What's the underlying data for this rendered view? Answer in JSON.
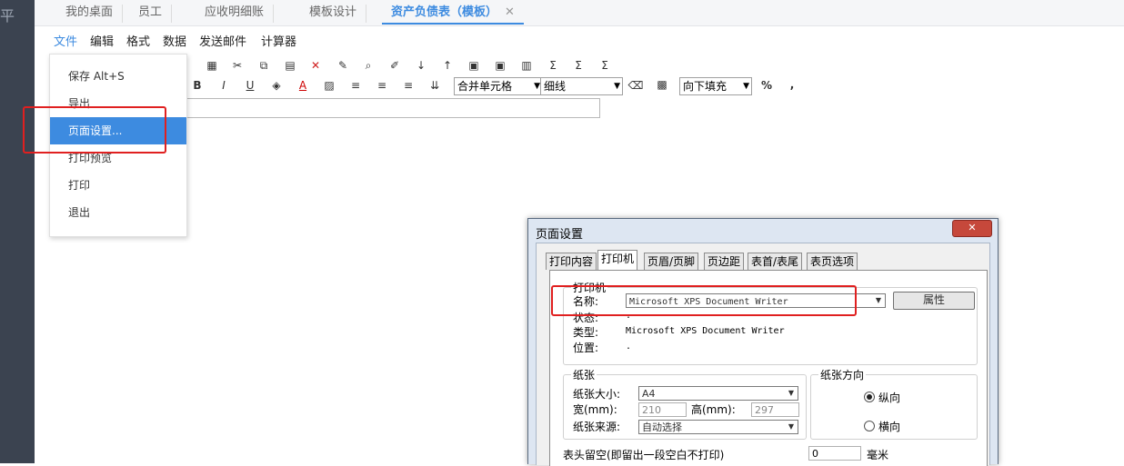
{
  "sidebar": {
    "glyph": "平"
  },
  "tabs": [
    {
      "label": "我的桌面"
    },
    {
      "label": "员工"
    },
    {
      "label": "应收明细账"
    },
    {
      "label": "模板设计"
    },
    {
      "label": "资产负债表（模板）",
      "close": "✕"
    }
  ],
  "menubar": {
    "items": [
      "文件",
      "编辑",
      "格式",
      "数据",
      "发送邮件",
      "计算器"
    ]
  },
  "toolbar": {
    "merge_select": "合并单元格",
    "line_select": "细线",
    "fill_select": "向下填充",
    "percent": "%",
    "comma": ","
  },
  "file_menu": {
    "items": [
      "保存 Alt+S",
      "导出",
      "页面设置...",
      "打印预览",
      "打印",
      "退出"
    ]
  },
  "dialog": {
    "title": "页面设置",
    "close": "✕",
    "tabs": [
      "打印内容",
      "打印机",
      "页眉/页脚",
      "页边距",
      "表首/表尾",
      "表页选项"
    ],
    "printer": {
      "group": "打印机",
      "name_label": "名称:",
      "name_value": "Microsoft XPS Document Writer",
      "props_button": "属性",
      "status_label": "状态:",
      "status_value": ".",
      "type_label": "类型:",
      "type_value": "Microsoft XPS Document Writer",
      "location_label": "位置:",
      "location_value": "."
    },
    "paper": {
      "group": "纸张",
      "size_label": "纸张大小:",
      "size_value": "A4",
      "width_label": "宽(mm):",
      "width_value": "210",
      "height_label": "高(mm):",
      "height_value": "297",
      "source_label": "纸张来源:",
      "source_value": "自动选择"
    },
    "orientation": {
      "group": "纸张方向",
      "portrait": "纵向",
      "landscape": "横向"
    },
    "header_margin": {
      "label": "表头留空(即留出一段空白不打印)",
      "value": "0",
      "unit": "毫米"
    }
  }
}
